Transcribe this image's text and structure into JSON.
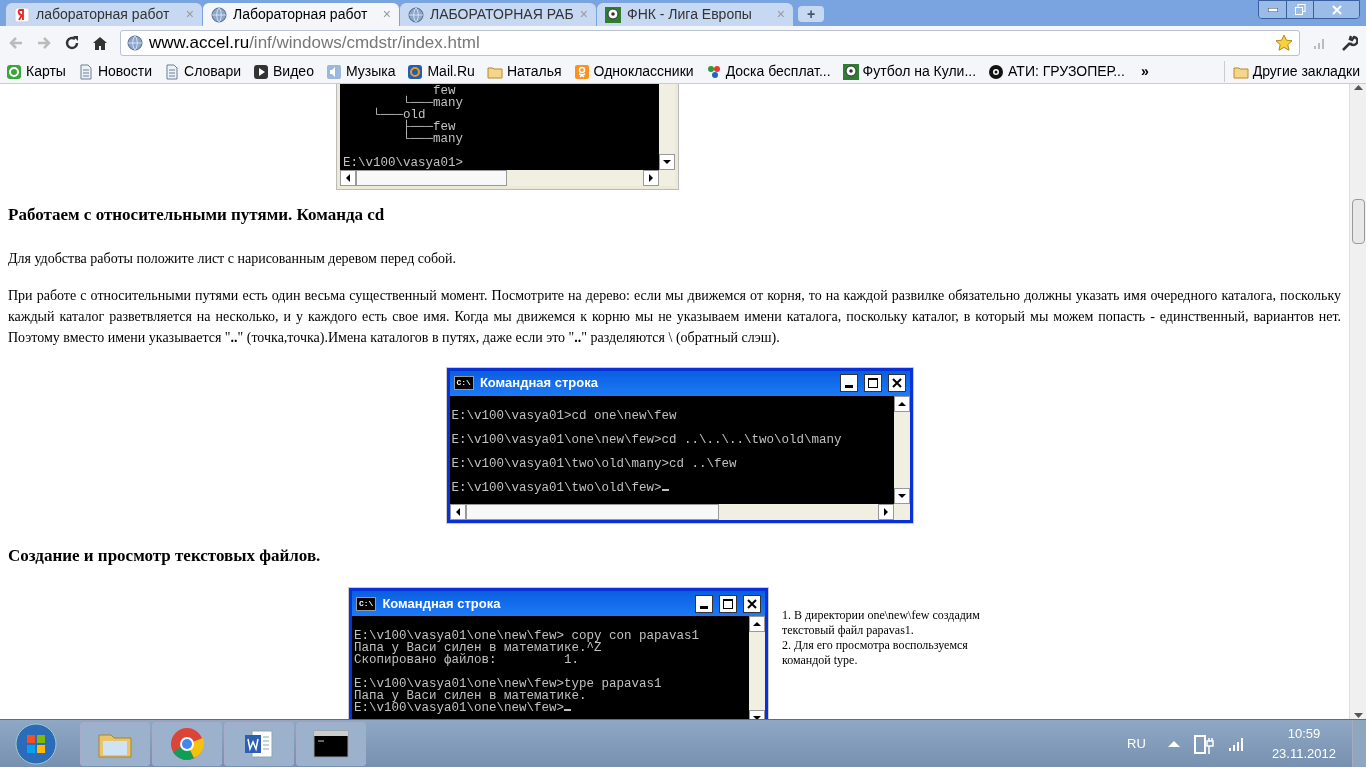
{
  "tabs": [
    {
      "title": "лабораторная работ",
      "close": "×",
      "kind": "yandex",
      "selected": false
    },
    {
      "title": "Лабораторная работ",
      "close": "×",
      "kind": "globe",
      "selected": true
    },
    {
      "title": "ЛАБОРАТОРНАЯ РАБ",
      "close": "×",
      "kind": "globe",
      "selected": false
    },
    {
      "title": "ФНК - Лига Европы",
      "close": "×",
      "kind": "ball",
      "selected": false
    }
  ],
  "new_tab": "+",
  "address": {
    "host": "www.accel.ru",
    "path": "/inf/windows/cmdstr/index.html"
  },
  "bookmarks": [
    {
      "label": "Карты",
      "kind": "map"
    },
    {
      "label": "Новости",
      "kind": "doc"
    },
    {
      "label": "Словари",
      "kind": "doc"
    },
    {
      "label": "Видео",
      "kind": "play"
    },
    {
      "label": "Музыка",
      "kind": "sound"
    },
    {
      "label": "Mail.Ru",
      "kind": "at"
    },
    {
      "label": "Наталья",
      "kind": "folder"
    },
    {
      "label": "Одноклассники",
      "kind": "ok"
    },
    {
      "label": "Доска бесплат...",
      "kind": "dots"
    },
    {
      "label": "Футбол на Кули...",
      "kind": "ball"
    },
    {
      "label": "АТИ: ГРУЗОПЕР...",
      "kind": "wheel"
    }
  ],
  "bookmarks_overflow": "»",
  "other_bookmarks": "Другие закладки",
  "console_top": {
    "groups": [
      [
        "            few",
        "        └───many",
        "    └───old",
        "        ├───few",
        "        └───many"
      ],
      [
        "E:\\v100\\vasya01>"
      ]
    ]
  },
  "heading_1": "Работаем с относительными путями. Команда cd",
  "paragraph_1": "Для удобства работы положите лист с нарисованным деревом перед собой.",
  "paragraph_2": "При работе с относительными путями есть один весьма существенный момент. Посмотрите на дерево: если мы движемся от корня, то на каждой развилке обязательно должны указать имя очередного каталога, поскольку каждый каталог разветвляется на несколько, и у каждого есть свое имя. Когда мы движемся к корню мы не указываем имени каталога, поскольку каталог, в который мы можем попасть - единственный, вариантов нет. Поэтому вместо имени указывается \"**..**\" (точка,точка).Имена каталогов в путях, даже если это \"**..**\" разделяются \\ (обратный слэш).",
  "console_cd": {
    "title": "Командная строка",
    "icon": "C:\\",
    "groups": [
      [
        "E:\\v100\\vasya01>cd one\\new\\few"
      ],
      [
        "E:\\v100\\vasya01\\one\\new\\few>cd ..\\..\\..\\two\\old\\many"
      ],
      [
        "E:\\v100\\vasya01\\two\\old\\many>cd ..\\few"
      ],
      [
        "E:\\v100\\vasya01\\two\\old\\few>"
      ]
    ],
    "cursor": true
  },
  "heading_2": "Создание и просмотр текстовых файлов.",
  "console_type": {
    "title": "Командная строка",
    "icon": "C:\\",
    "groups": [
      [
        "E:\\v100\\vasya01\\one\\new\\few> copy con papavas1",
        "Папа у Васи силен в математике.^Z",
        "Скопировано файлов:         1."
      ],
      [
        "E:\\v100\\vasya01\\one\\new\\few>type papavas1",
        "Папа у Васи силен в математике.",
        "E:\\v100\\vasya01\\one\\new\\few>"
      ]
    ],
    "cursor": true
  },
  "note": [
    "1. В директории one\\new\\few создадим текстовый файл papavas1.",
    "2. Для его просмотра воспользуемся командой type."
  ],
  "taskbar": {
    "apps": [
      {
        "kind": "explorer"
      },
      {
        "kind": "chrome"
      },
      {
        "kind": "word"
      },
      {
        "kind": "cmd"
      }
    ],
    "language": "RU",
    "time": "10:59",
    "date": "23.11.2012"
  }
}
